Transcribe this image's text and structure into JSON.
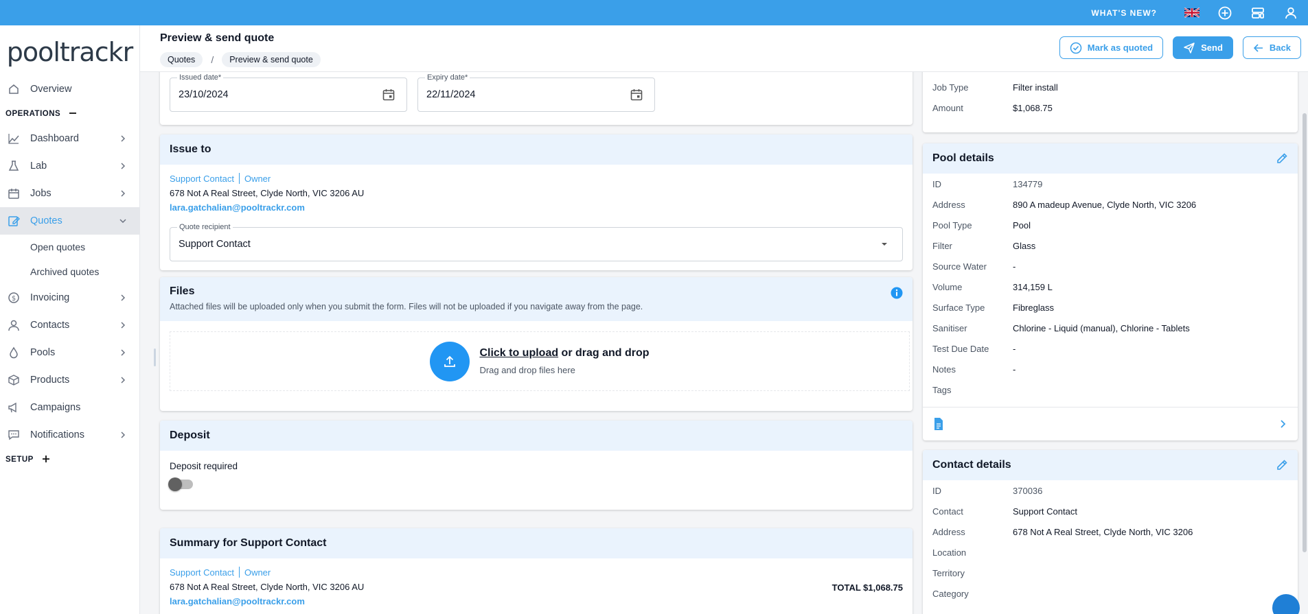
{
  "topbar": {
    "whats_new": "WHAT'S NEW?",
    "icons": [
      "uk-flag-icon",
      "add-circle-icon",
      "dashboard-customize-icon",
      "user-icon"
    ]
  },
  "sidebar": {
    "logo": "pooltrackr",
    "overview": "Overview",
    "operations": "OPERATIONS",
    "items": [
      {
        "label": "Dashboard"
      },
      {
        "label": "Lab"
      },
      {
        "label": "Jobs"
      },
      {
        "label": "Quotes"
      }
    ],
    "quotes_sub": [
      "Open quotes",
      "Archived quotes"
    ],
    "items2": [
      {
        "label": "Invoicing"
      },
      {
        "label": "Contacts"
      },
      {
        "label": "Pools"
      },
      {
        "label": "Products"
      },
      {
        "label": "Campaigns"
      },
      {
        "label": "Notifications"
      }
    ],
    "setup": "SETUP"
  },
  "header": {
    "title": "Preview & send quote",
    "breadcrumb": [
      "Quotes",
      "Preview & send quote"
    ],
    "breadcrumb_sep": "/",
    "mark_quoted": "Mark as quoted",
    "send": "Send",
    "back": "Back"
  },
  "dates": {
    "issued_label": "Issued date",
    "issued_value": "23/10/2024",
    "expiry_label": "Expiry date",
    "expiry_value": "22/11/2024",
    "required": "*"
  },
  "issue_to": {
    "title": "Issue to",
    "contact": "Support Contact",
    "role": "Owner",
    "address": "678 Not A Real Street, Clyde North, VIC 3206 AU",
    "email": "lara.gatchalian@pooltrackr.com",
    "recipient_label": "Quote recipient",
    "recipient_value": "Support Contact"
  },
  "files": {
    "title": "Files",
    "note": "Attached files will be uploaded only when you submit the form. Files will not be uploaded if you navigate away from the page.",
    "click_upload": "Click to upload",
    "or_drag": " or drag and drop",
    "hint": "Drag and drop files here"
  },
  "deposit": {
    "title": "Deposit",
    "label": "Deposit required",
    "enabled": false
  },
  "summary": {
    "title": "Summary for Support Contact",
    "contact": "Support Contact",
    "role": "Owner",
    "address": "678 Not A Real Street, Clyde North, VIC 3206 AU",
    "email": "lara.gatchalian@pooltrackr.com",
    "total": "TOTAL $1,068.75"
  },
  "job_info": {
    "rows": [
      {
        "k": "Job Type",
        "v": "Filter install"
      },
      {
        "k": "Amount",
        "v": "$1,068.75"
      }
    ]
  },
  "pool_details": {
    "title": "Pool details",
    "rows": [
      {
        "k": "ID",
        "v": "134779"
      },
      {
        "k": "Address",
        "v": "890 A madeup Avenue, Clyde North, VIC 3206"
      },
      {
        "k": "Pool Type",
        "v": "Pool"
      },
      {
        "k": "Filter",
        "v": "Glass"
      },
      {
        "k": "Source Water",
        "v": "-"
      },
      {
        "k": "Volume",
        "v": "314,159 L"
      },
      {
        "k": "Surface Type",
        "v": "Fibreglass"
      },
      {
        "k": "Sanitiser",
        "v": "Chlorine - Liquid (manual), Chlorine - Tablets"
      },
      {
        "k": "Test Due Date",
        "v": "-"
      },
      {
        "k": "Notes",
        "v": "-"
      },
      {
        "k": "Tags",
        "v": ""
      }
    ]
  },
  "contact_details": {
    "title": "Contact details",
    "rows": [
      {
        "k": "ID",
        "v": "370036"
      },
      {
        "k": "Contact",
        "v": "Support Contact"
      },
      {
        "k": "Address",
        "v": "678 Not A Real Street, Clyde North, VIC 3206"
      },
      {
        "k": "Location",
        "v": ""
      },
      {
        "k": "Territory",
        "v": ""
      },
      {
        "k": "Category",
        "v": ""
      }
    ]
  }
}
